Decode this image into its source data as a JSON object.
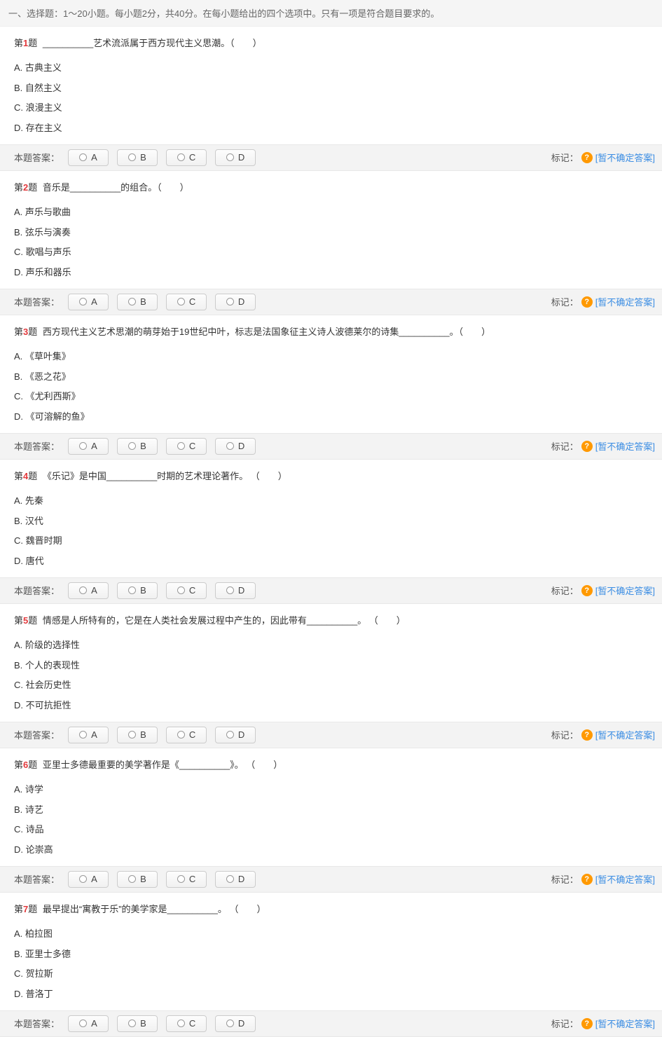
{
  "section_header": "一、选择题：1～20小题。每小题2分，共40分。在每小题给出的四个选项中。只有一项是符合题目要求的。",
  "labels": {
    "q_prefix": "第",
    "q_suffix": "题",
    "answer_label": "本题答案：",
    "mark_label": "标记：",
    "help_icon": "?",
    "uncertain": "[暂不确定答案]",
    "btn_A": "A",
    "btn_B": "B",
    "btn_C": "C",
    "btn_D": "D"
  },
  "questions": [
    {
      "num": "1",
      "text": "__________艺术流派属于西方现代主义思潮。（　　）",
      "options": [
        "A. 古典主义",
        "B. 自然主义",
        "C. 浪漫主义",
        "D. 存在主义"
      ]
    },
    {
      "num": "2",
      "text": "音乐是__________的组合。（　　）",
      "options": [
        "A. 声乐与歌曲",
        "B. 弦乐与演奏",
        "C. 歌唱与声乐",
        "D. 声乐和器乐"
      ]
    },
    {
      "num": "3",
      "text": "西方现代主义艺术思潮的萌芽始于19世纪中叶，标志是法国象征主义诗人波德莱尔的诗集__________。（　　）",
      "options": [
        "A. 《草叶集》",
        "B. 《恶之花》",
        "C. 《尤利西斯》",
        "D. 《可溶解的鱼》"
      ]
    },
    {
      "num": "4",
      "text": "《乐记》是中国__________时期的艺术理论著作。 （　　）",
      "options": [
        "A. 先秦",
        "B. 汉代",
        "C. 魏晋时期",
        "D. 唐代"
      ]
    },
    {
      "num": "5",
      "text": "情感是人所特有的，它是在人类社会发展过程中产生的，因此带有__________。 （　　）",
      "options": [
        "A. 阶级的选择性",
        "B. 个人的表现性",
        "C. 社会历史性",
        "D. 不可抗拒性"
      ]
    },
    {
      "num": "6",
      "text": "亚里士多德最重要的美学著作是《__________》。 （　　）",
      "options": [
        "A. 诗学",
        "B. 诗艺",
        "C. 诗品",
        "D. 论崇高"
      ]
    },
    {
      "num": "7",
      "text": "最早提出“寓教于乐”的美学家是__________。 （　　）",
      "options": [
        "A. 柏拉图",
        "B. 亚里士多德",
        "C. 贺拉斯",
        "D. 普洛丁"
      ]
    }
  ]
}
